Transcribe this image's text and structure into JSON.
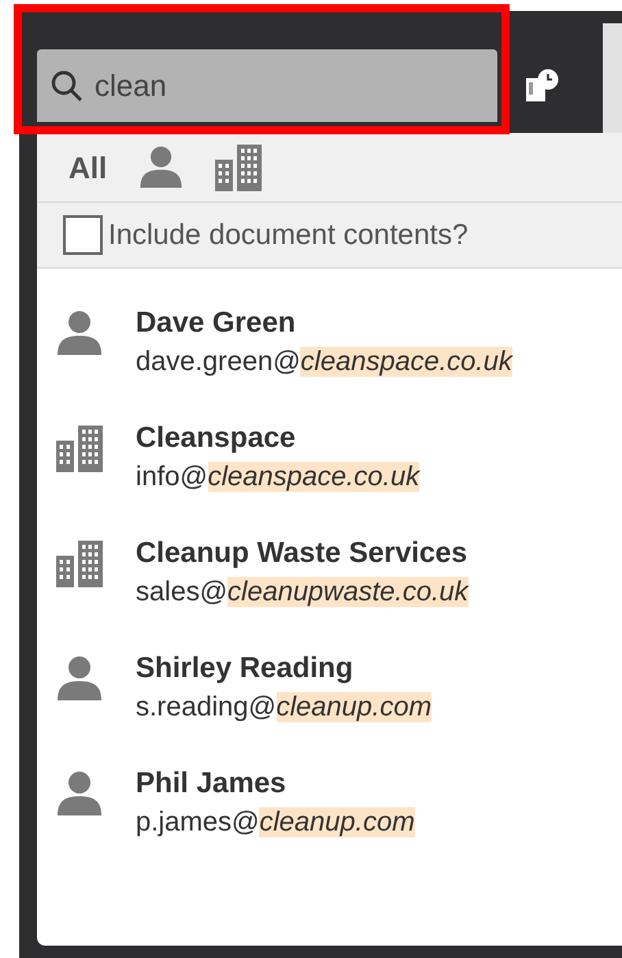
{
  "search": {
    "value": "clean"
  },
  "filters": [
    {
      "kind": "text",
      "label": "All"
    },
    {
      "kind": "person"
    },
    {
      "kind": "building"
    }
  ],
  "include_contents": {
    "label": "Include document contents?",
    "checked": false
  },
  "results": [
    {
      "kind": "person",
      "name": "Dave Green",
      "email_prefix": "dave.green@",
      "email_match": "cleanspace.co.uk"
    },
    {
      "kind": "company",
      "name": "Cleanspace",
      "email_prefix": "info@",
      "email_match": "cleanspace.co.uk"
    },
    {
      "kind": "company",
      "name": "Cleanup Waste Services",
      "email_prefix": "sales@",
      "email_match": "cleanupwaste.co.uk"
    },
    {
      "kind": "person",
      "name": "Shirley Reading",
      "email_prefix": "s.reading@",
      "email_match": "cleanup.com"
    },
    {
      "kind": "person",
      "name": "Phil James",
      "email_prefix": "p.james@",
      "email_match": "cleanup.com"
    }
  ]
}
